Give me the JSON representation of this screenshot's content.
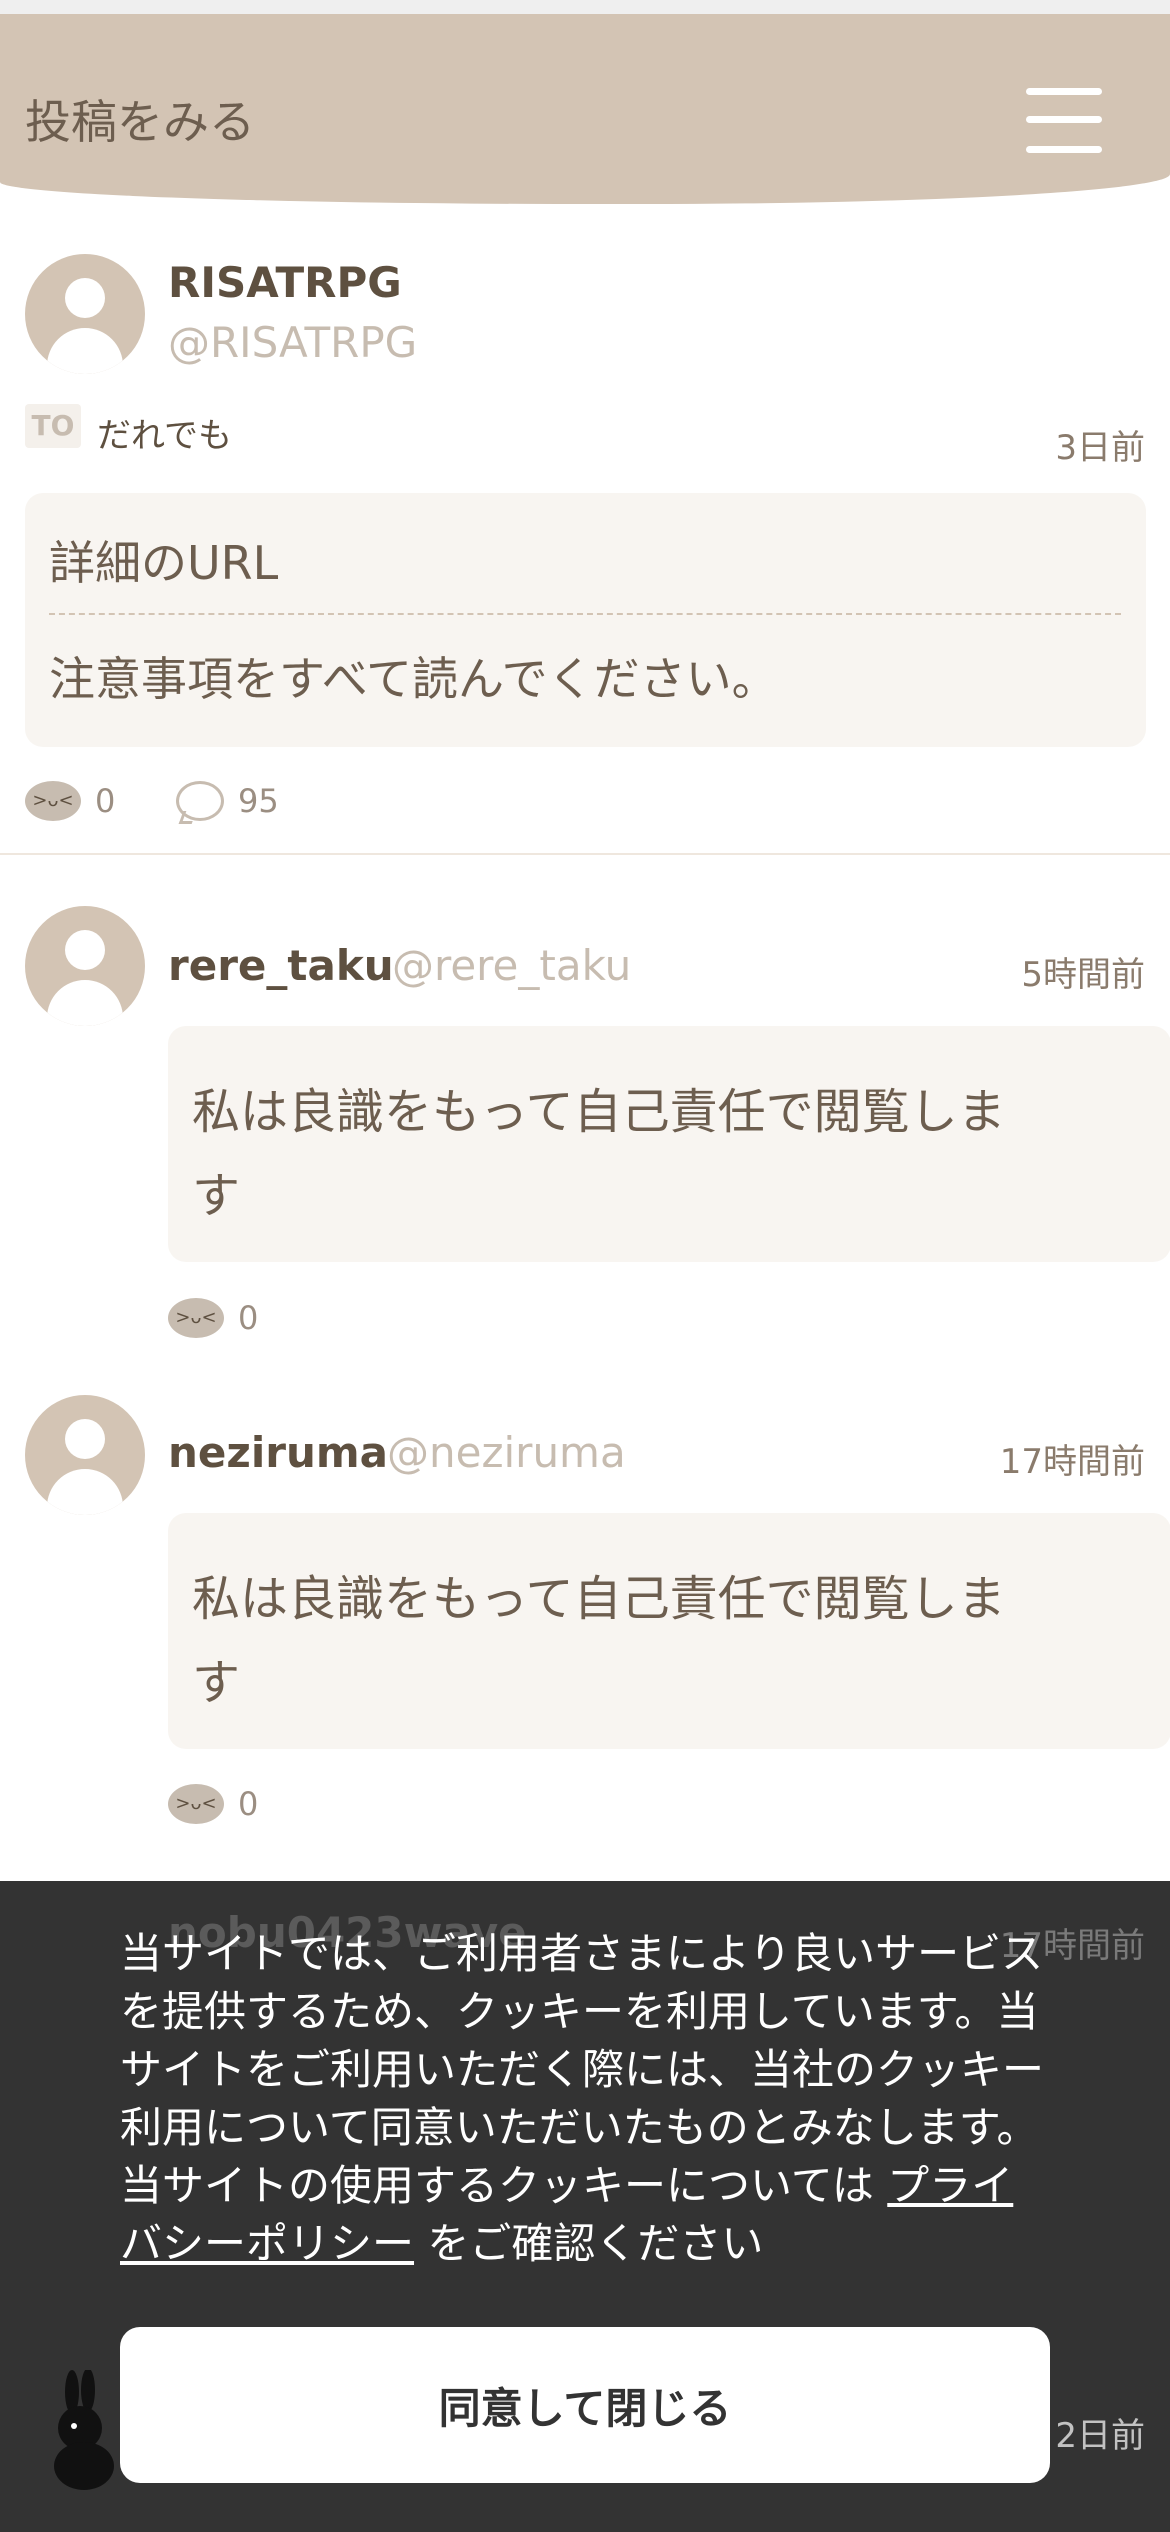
{
  "header": {
    "title": "投稿をみる",
    "menu_icon": "hamburger-icon"
  },
  "post": {
    "display_name": "RISATRPG",
    "handle": "@RISATRPG",
    "to_badge": "TO",
    "to_text": "だれでも",
    "time": "3日前",
    "line1": "詳細のURL",
    "line2": "注意事項をすべて読んでください。",
    "reaction_count": "0",
    "comment_count": "95"
  },
  "replies": [
    {
      "display_name": "rere_taku",
      "handle": "@rere_taku",
      "time": "5時間前",
      "text": "私は良識をもって自己責任で閲覧します",
      "reaction_count": "0"
    },
    {
      "display_name": "neziruma",
      "handle": "@neziruma",
      "time": "17時間前",
      "text": "私は良識をもって自己責任で閲覧します",
      "reaction_count": "0"
    }
  ],
  "behind": {
    "name": "nobu0423wave",
    "time": "17時間前",
    "time2": "2日前"
  },
  "cookie": {
    "text": "当サイトでは、ご利用者さまにより良いサービスを提供するため、クッキーを利用しています。当サイトをご利用いただく際には、当社のクッキー利用について同意いただいたものとみなします。当サイトの使用するクッキーについては",
    "link": "プライバシーポリシー",
    "text_after": "をご確認ください",
    "button": "同意して閉じる"
  }
}
